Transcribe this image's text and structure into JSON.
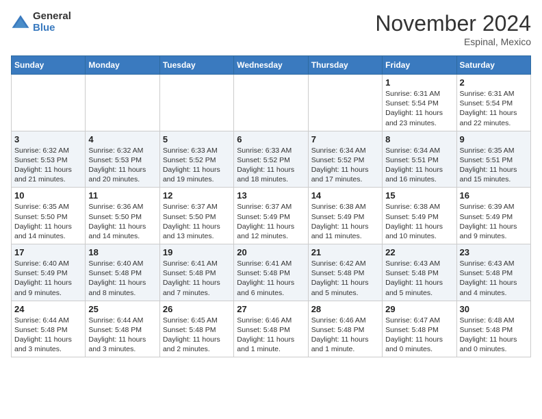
{
  "header": {
    "logo_general": "General",
    "logo_blue": "Blue",
    "month_title": "November 2024",
    "location": "Espinal, Mexico"
  },
  "weekdays": [
    "Sunday",
    "Monday",
    "Tuesday",
    "Wednesday",
    "Thursday",
    "Friday",
    "Saturday"
  ],
  "weeks": [
    [
      {
        "day": "",
        "info": ""
      },
      {
        "day": "",
        "info": ""
      },
      {
        "day": "",
        "info": ""
      },
      {
        "day": "",
        "info": ""
      },
      {
        "day": "",
        "info": ""
      },
      {
        "day": "1",
        "info": "Sunrise: 6:31 AM\nSunset: 5:54 PM\nDaylight: 11 hours and 23 minutes."
      },
      {
        "day": "2",
        "info": "Sunrise: 6:31 AM\nSunset: 5:54 PM\nDaylight: 11 hours and 22 minutes."
      }
    ],
    [
      {
        "day": "3",
        "info": "Sunrise: 6:32 AM\nSunset: 5:53 PM\nDaylight: 11 hours and 21 minutes."
      },
      {
        "day": "4",
        "info": "Sunrise: 6:32 AM\nSunset: 5:53 PM\nDaylight: 11 hours and 20 minutes."
      },
      {
        "day": "5",
        "info": "Sunrise: 6:33 AM\nSunset: 5:52 PM\nDaylight: 11 hours and 19 minutes."
      },
      {
        "day": "6",
        "info": "Sunrise: 6:33 AM\nSunset: 5:52 PM\nDaylight: 11 hours and 18 minutes."
      },
      {
        "day": "7",
        "info": "Sunrise: 6:34 AM\nSunset: 5:52 PM\nDaylight: 11 hours and 17 minutes."
      },
      {
        "day": "8",
        "info": "Sunrise: 6:34 AM\nSunset: 5:51 PM\nDaylight: 11 hours and 16 minutes."
      },
      {
        "day": "9",
        "info": "Sunrise: 6:35 AM\nSunset: 5:51 PM\nDaylight: 11 hours and 15 minutes."
      }
    ],
    [
      {
        "day": "10",
        "info": "Sunrise: 6:35 AM\nSunset: 5:50 PM\nDaylight: 11 hours and 14 minutes."
      },
      {
        "day": "11",
        "info": "Sunrise: 6:36 AM\nSunset: 5:50 PM\nDaylight: 11 hours and 14 minutes."
      },
      {
        "day": "12",
        "info": "Sunrise: 6:37 AM\nSunset: 5:50 PM\nDaylight: 11 hours and 13 minutes."
      },
      {
        "day": "13",
        "info": "Sunrise: 6:37 AM\nSunset: 5:49 PM\nDaylight: 11 hours and 12 minutes."
      },
      {
        "day": "14",
        "info": "Sunrise: 6:38 AM\nSunset: 5:49 PM\nDaylight: 11 hours and 11 minutes."
      },
      {
        "day": "15",
        "info": "Sunrise: 6:38 AM\nSunset: 5:49 PM\nDaylight: 11 hours and 10 minutes."
      },
      {
        "day": "16",
        "info": "Sunrise: 6:39 AM\nSunset: 5:49 PM\nDaylight: 11 hours and 9 minutes."
      }
    ],
    [
      {
        "day": "17",
        "info": "Sunrise: 6:40 AM\nSunset: 5:49 PM\nDaylight: 11 hours and 9 minutes."
      },
      {
        "day": "18",
        "info": "Sunrise: 6:40 AM\nSunset: 5:48 PM\nDaylight: 11 hours and 8 minutes."
      },
      {
        "day": "19",
        "info": "Sunrise: 6:41 AM\nSunset: 5:48 PM\nDaylight: 11 hours and 7 minutes."
      },
      {
        "day": "20",
        "info": "Sunrise: 6:41 AM\nSunset: 5:48 PM\nDaylight: 11 hours and 6 minutes."
      },
      {
        "day": "21",
        "info": "Sunrise: 6:42 AM\nSunset: 5:48 PM\nDaylight: 11 hours and 5 minutes."
      },
      {
        "day": "22",
        "info": "Sunrise: 6:43 AM\nSunset: 5:48 PM\nDaylight: 11 hours and 5 minutes."
      },
      {
        "day": "23",
        "info": "Sunrise: 6:43 AM\nSunset: 5:48 PM\nDaylight: 11 hours and 4 minutes."
      }
    ],
    [
      {
        "day": "24",
        "info": "Sunrise: 6:44 AM\nSunset: 5:48 PM\nDaylight: 11 hours and 3 minutes."
      },
      {
        "day": "25",
        "info": "Sunrise: 6:44 AM\nSunset: 5:48 PM\nDaylight: 11 hours and 3 minutes."
      },
      {
        "day": "26",
        "info": "Sunrise: 6:45 AM\nSunset: 5:48 PM\nDaylight: 11 hours and 2 minutes."
      },
      {
        "day": "27",
        "info": "Sunrise: 6:46 AM\nSunset: 5:48 PM\nDaylight: 11 hours and 1 minute."
      },
      {
        "day": "28",
        "info": "Sunrise: 6:46 AM\nSunset: 5:48 PM\nDaylight: 11 hours and 1 minute."
      },
      {
        "day": "29",
        "info": "Sunrise: 6:47 AM\nSunset: 5:48 PM\nDaylight: 11 hours and 0 minutes."
      },
      {
        "day": "30",
        "info": "Sunrise: 6:48 AM\nSunset: 5:48 PM\nDaylight: 11 hours and 0 minutes."
      }
    ]
  ]
}
